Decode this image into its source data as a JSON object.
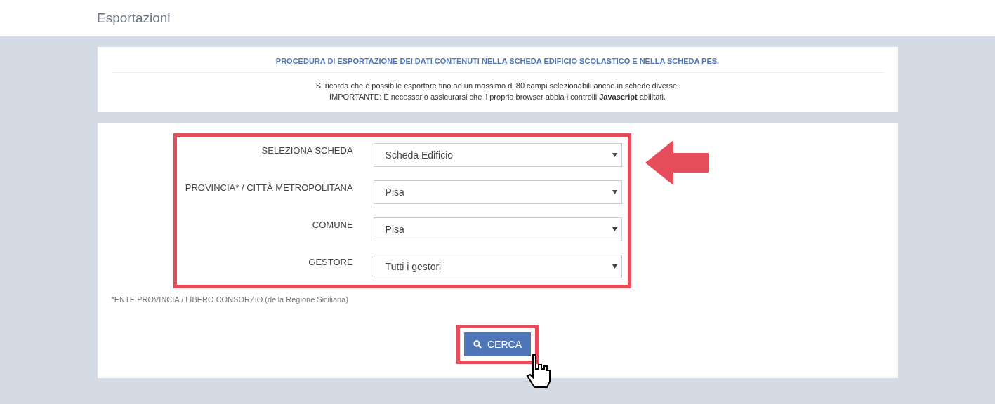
{
  "page_title": "Esportazioni",
  "info": {
    "heading": "PROCEDURA DI ESPORTAZIONE DEI DATI CONTENUTI NELLA SCHEDA EDIFICIO SCOLASTICO E NELLA SCHEDA PES.",
    "lines": [
      "Si ricorda che è possibile esportare fino ad un massimo di 80 campi selezionabili anche in schede diverse.",
      "IMPORTANTE: È necessario assicurarsi che il proprio browser abbia i controlli **Javascript** abilitati."
    ]
  },
  "form": {
    "fields": [
      {
        "label": "SELEZIONA SCHEDA",
        "value": "Scheda Edificio"
      },
      {
        "label": "PROVINCIA* / CITTÀ METROPOLITANA",
        "value": "Pisa"
      },
      {
        "label": "COMUNE",
        "value": "Pisa"
      },
      {
        "label": "GESTORE",
        "value": "Tutti i gestori"
      }
    ],
    "footnote": "*ENTE PROVINCIA / LIBERO CONSORZIO (della Regione Siciliana)",
    "search_button": "CERCA"
  }
}
